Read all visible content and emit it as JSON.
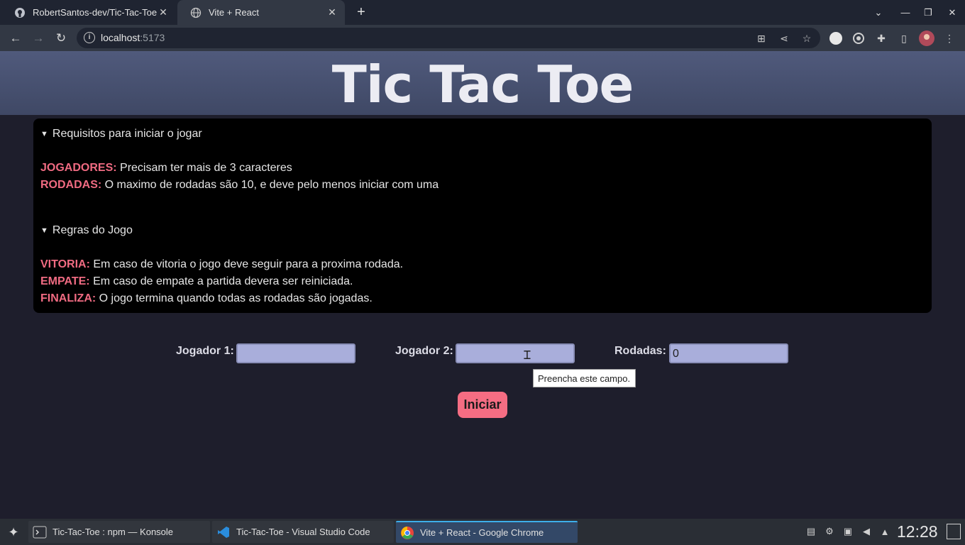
{
  "browser": {
    "tabs": [
      {
        "title": "RobertSantos-dev/Tic-Tac-Toe",
        "favicon": "github-icon"
      },
      {
        "title": "Vite + React",
        "favicon": "globe-icon"
      }
    ],
    "address": {
      "host": "localhost",
      "port": ":5173"
    }
  },
  "page": {
    "title": "Tic Tac Toe",
    "sections": [
      {
        "summary": "Requisitos para iniciar o jogar",
        "items": [
          {
            "key": "JOGADORES:",
            "text": " Precisam ter mais de 3 caracteres"
          },
          {
            "key": "RODADAS:",
            "text": " O maximo de rodadas são 10, e deve pelo menos iniciar com uma"
          }
        ]
      },
      {
        "summary": "Regras do Jogo",
        "items": [
          {
            "key": "VITORIA:",
            "text": " Em caso de vitoria o jogo deve seguir para a proxima rodada."
          },
          {
            "key": "EMPATE:",
            "text": " Em caso de empate a partida devera ser reiniciada."
          },
          {
            "key": "FINALIZA:",
            "text": " O jogo termina quando todas as rodadas são jogadas."
          }
        ]
      }
    ],
    "form": {
      "player1_label": "Jogador 1:",
      "player1_value": "",
      "player2_label": "Jogador 2:",
      "player2_value": "",
      "rounds_label": "Rodadas:",
      "rounds_value": "0",
      "tooltip": "Preencha este campo.",
      "start_label": "Iniciar"
    }
  },
  "taskbar": {
    "tasks": [
      {
        "label": "Tic-Tac-Toe : npm — Konsole",
        "icon": "terminal-icon"
      },
      {
        "label": "Tic-Tac-Toe - Visual Studio Code",
        "icon": "vscode-icon"
      },
      {
        "label": "Vite + React - Google Chrome",
        "icon": "chrome-icon"
      }
    ],
    "clock": "12:28"
  },
  "colors": {
    "accent": "#f06b82",
    "button": "#f56d83",
    "input": "#a9aedb",
    "header": "#48516f"
  }
}
